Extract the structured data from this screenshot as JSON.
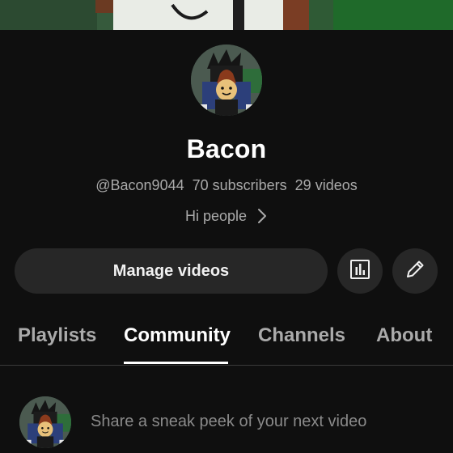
{
  "channel": {
    "name": "Bacon",
    "handle": "@Bacon9044",
    "subscribers": "70 subscribers",
    "videos": "29 videos",
    "about_text": "Hi people"
  },
  "actions": {
    "manage_label": "Manage videos",
    "stats_icon": "bar-chart-icon",
    "edit_icon": "pencil-icon"
  },
  "tabs": [
    {
      "label": "Playlists",
      "active": false
    },
    {
      "label": "Community",
      "active": true
    },
    {
      "label": "Channels",
      "active": false
    },
    {
      "label": "About",
      "active": false
    }
  ],
  "post": {
    "placeholder": "Share a sneak peek of your next video"
  },
  "colors": {
    "background": "#0f0f0f",
    "button_bg": "#272727",
    "text_primary": "#ffffff",
    "text_secondary": "#aaaaaa"
  }
}
